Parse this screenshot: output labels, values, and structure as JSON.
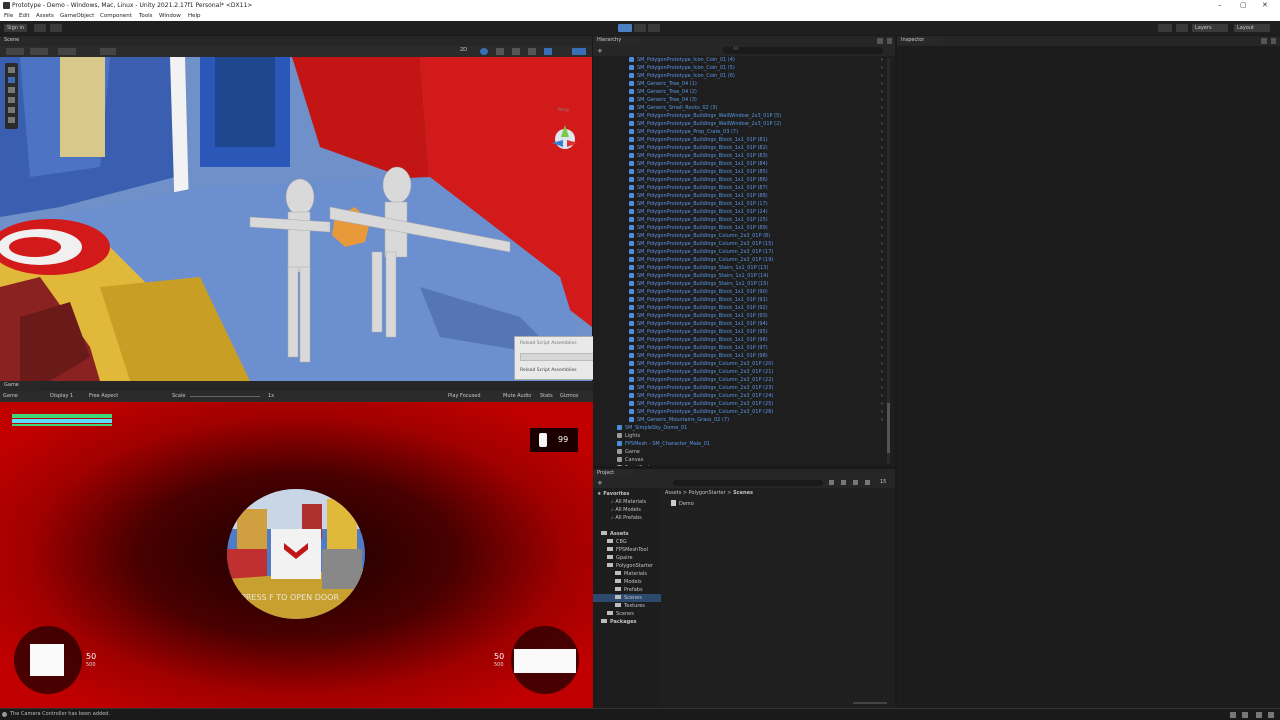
{
  "window": {
    "title": "Prototype - Demo - Windows, Mac, Linux - Unity 2021.2.17f1 Personal* <DX11>",
    "minimize": "–",
    "maximize": "▢",
    "close": "✕"
  },
  "menu": [
    "File",
    "Edit",
    "Assets",
    "GameObject",
    "Component",
    "Tools",
    "Window",
    "Help"
  ],
  "toolbar": {
    "sign_in": "Sign in",
    "layers": "Layers",
    "layout": "Layout"
  },
  "scene_panel": {
    "tab": "Scene",
    "mode_2d": "2D",
    "persp": "Persp"
  },
  "game_panel": {
    "tab": "Game",
    "display_tab": "Game",
    "display": "Display 1",
    "aspect": "Free Aspect",
    "scale_label": "Scale",
    "scale_value": "1x",
    "play_focused": "Play Focused",
    "mute_audio": "Mute Audio",
    "stats": "Stats",
    "gizmos": "Gizmos",
    "ammo_count": "99",
    "prompt": "PRESS F TO OPEN DOOR",
    "left_ammo_top": "50",
    "left_ammo_bottom": "500",
    "right_ammo_top": "50",
    "right_ammo_bottom": "500"
  },
  "hierarchy": {
    "tab": "Hierarchy",
    "search_placeholder": "All",
    "items": [
      "SM_PolygonPrototype_Icon_Coin_01 (4)",
      "SM_PolygonPrototype_Icon_Coin_01 (5)",
      "SM_PolygonPrototype_Icon_Coin_01 (6)",
      "SM_Generic_Tree_04 (1)",
      "SM_Generic_Tree_04 (2)",
      "SM_Generic_Tree_04 (3)",
      "SM_Generic_Small_Rocks_02 (3)",
      "SM_PolygonPrototype_Buildings_WallWindow_2x3_01P (5)",
      "SM_PolygonPrototype_Buildings_WallWindow_2x3_01P (2)",
      "SM_PolygonPrototype_Prop_Crate_03 (7)",
      "SM_PolygonPrototype_Buildings_Block_1x1_01P (81)",
      "SM_PolygonPrototype_Buildings_Block_1x1_01P (82)",
      "SM_PolygonPrototype_Buildings_Block_1x1_01P (83)",
      "SM_PolygonPrototype_Buildings_Block_1x1_01P (84)",
      "SM_PolygonPrototype_Buildings_Block_1x1_01P (85)",
      "SM_PolygonPrototype_Buildings_Block_1x1_01P (86)",
      "SM_PolygonPrototype_Buildings_Block_1x1_01P (87)",
      "SM_PolygonPrototype_Buildings_Block_1x1_01P (88)",
      "SM_PolygonPrototype_Buildings_Block_1x1_01P (17)",
      "SM_PolygonPrototype_Buildings_Block_1x1_01P (24)",
      "SM_PolygonPrototype_Buildings_Block_1x1_01P (25)",
      "SM_PolygonPrototype_Buildings_Block_1x1_01P (89)",
      "SM_PolygonPrototype_Buildings_Column_2x3_01P (8)",
      "SM_PolygonPrototype_Buildings_Column_2x3_01P (15)",
      "SM_PolygonPrototype_Buildings_Column_2x3_01P (17)",
      "SM_PolygonPrototype_Buildings_Column_2x3_01P (19)",
      "SM_PolygonPrototype_Buildings_Stairs_1x1_01P (13)",
      "SM_PolygonPrototype_Buildings_Stairs_1x1_01P (14)",
      "SM_PolygonPrototype_Buildings_Stairs_1x1_01P (15)",
      "SM_PolygonPrototype_Buildings_Block_1x1_01P (90)",
      "SM_PolygonPrototype_Buildings_Block_1x1_01P (91)",
      "SM_PolygonPrototype_Buildings_Block_1x1_01P (92)",
      "SM_PolygonPrototype_Buildings_Block_1x1_01P (93)",
      "SM_PolygonPrototype_Buildings_Block_1x1_01P (94)",
      "SM_PolygonPrototype_Buildings_Block_1x1_01P (95)",
      "SM_PolygonPrototype_Buildings_Block_1x1_01P (96)",
      "SM_PolygonPrototype_Buildings_Block_1x1_01P (97)",
      "SM_PolygonPrototype_Buildings_Block_1x1_01P (98)",
      "SM_PolygonPrototype_Buildings_Column_2x3_01P (20)",
      "SM_PolygonPrototype_Buildings_Column_2x3_01P (21)",
      "SM_PolygonPrototype_Buildings_Column_2x3_01P (22)",
      "SM_PolygonPrototype_Buildings_Column_2x3_01P (23)",
      "SM_PolygonPrototype_Buildings_Column_2x3_01P (24)",
      "SM_PolygonPrototype_Buildings_Column_2x3_01P (25)",
      "SM_PolygonPrototype_Buildings_Column_2x3_01P (26)",
      "SM_Generic_Mountains_Grass_02 (7)"
    ],
    "roots": [
      {
        "label": "SM_SimpleSky_Dome_01",
        "blue": true
      },
      {
        "label": "Lights",
        "blue": false
      },
      {
        "label": "FPSMesh - SM_Character_Male_01",
        "blue": true
      },
      {
        "label": "Game",
        "blue": false
      },
      {
        "label": "Canvas",
        "blue": false
      },
      {
        "label": "EventSystem",
        "blue": false
      }
    ]
  },
  "inspector": {
    "tab": "Inspector"
  },
  "project": {
    "tab": "Project",
    "breadcrumb_assets": "Assets",
    "breadcrumb_sep1": ">",
    "breadcrumb_starter": "PolygonStarter",
    "breadcrumb_sep2": ">",
    "breadcrumb_scenes": "Scenes",
    "favorites": "Favorites",
    "fav_items": [
      "All Materials",
      "All Models",
      "All Prefabs"
    ],
    "assets": "Assets",
    "asset_items": [
      "CBG",
      "FPSMeshTool",
      "Gpaire",
      "PolygonStarter"
    ],
    "starter_items": [
      "Materials",
      "Models",
      "Prefabs",
      "Scenes",
      "Textures"
    ],
    "scenes_root": "Scenes",
    "packages": "Packages",
    "file": "Demo",
    "count": "15"
  },
  "dialog": {
    "title": "Reload Script Assemblies",
    "status": "Reload Script Assemblies"
  },
  "status": {
    "message": "The Camera Controller has been added."
  },
  "colors": {
    "hierarchy_blue": "#5a97e8",
    "game_red": "#b80000",
    "health_green": "#3fd67a",
    "health_cyan": "#5ce0ff"
  }
}
